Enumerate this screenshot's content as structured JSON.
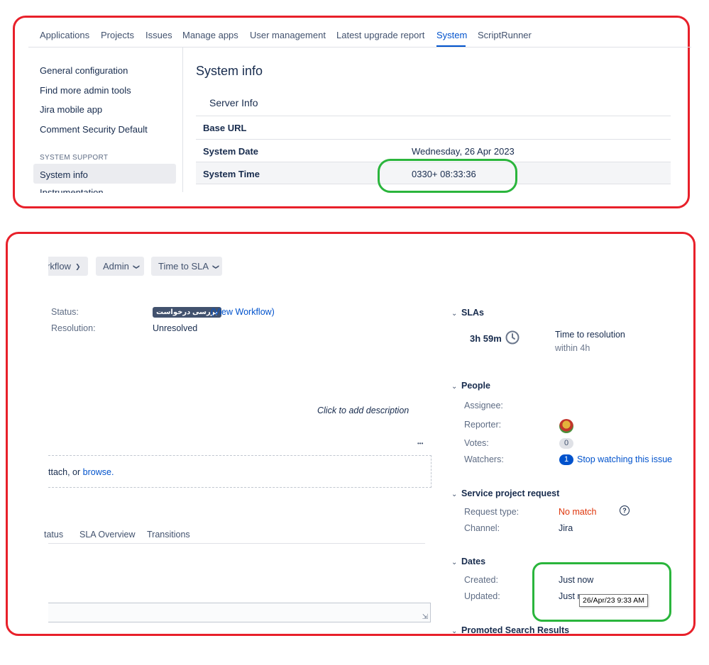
{
  "top": {
    "nav": [
      "Applications",
      "Projects",
      "Issues",
      "Manage apps",
      "User management",
      "Latest upgrade report",
      "System",
      "ScriptRunner"
    ],
    "sidebar": {
      "items": [
        "General configuration",
        "Find more admin tools",
        "Jira mobile app",
        "Comment Security Default"
      ],
      "section_title": "SYSTEM SUPPORT",
      "active_item": "System info",
      "cut_item": "Instrumentation"
    },
    "page_title": "System info",
    "section": "Server Info",
    "rows": [
      {
        "label": "Base URL",
        "value": ""
      },
      {
        "label": "System Date",
        "value": "Wednesday, 26 Apr 2023"
      },
      {
        "label": "System Time",
        "value": "0330+ 08:33:36"
      }
    ]
  },
  "bottom": {
    "buttons": [
      "rkflow",
      "Admin",
      "Time to SLA"
    ],
    "status_label": "Status:",
    "status_badge": "بررسی درخواست",
    "view_workflow": "(View Workflow)",
    "resolution_label": "Resolution:",
    "resolution_value": "Unresolved",
    "description_placeholder": "Click to add description",
    "more_glyph": "•••",
    "attach_text": "ttach, or",
    "browse_link": "browse.",
    "tabs": [
      "tatus",
      "SLA Overview",
      "Transitions"
    ],
    "slas": {
      "title": "SLAs",
      "time": "3h 59m",
      "name": "Time to resolution",
      "goal": "within 4h"
    },
    "people": {
      "title": "People",
      "assignee_label": "Assignee:",
      "reporter_label": "Reporter:",
      "votes_label": "Votes:",
      "votes_count": "0",
      "watchers_label": "Watchers:",
      "watchers_count": "1",
      "stop_watching": "Stop watching this issue"
    },
    "service": {
      "title": "Service project request",
      "request_type_label": "Request type:",
      "request_type_value": "No match",
      "help_glyph": "?",
      "channel_label": "Channel:",
      "channel_value": "Jira"
    },
    "dates": {
      "title": "Dates",
      "created_label": "Created:",
      "created_value": "Just now",
      "updated_label": "Updated:",
      "updated_value": "Just n",
      "tooltip": "26/Apr/23 9:33 AM"
    },
    "promoted": "Promoted Search Results"
  },
  "colors": {
    "highlight_red": "#e8202a",
    "highlight_green": "#2ab53c",
    "link": "#0052cc",
    "no_match": "#de350b"
  }
}
